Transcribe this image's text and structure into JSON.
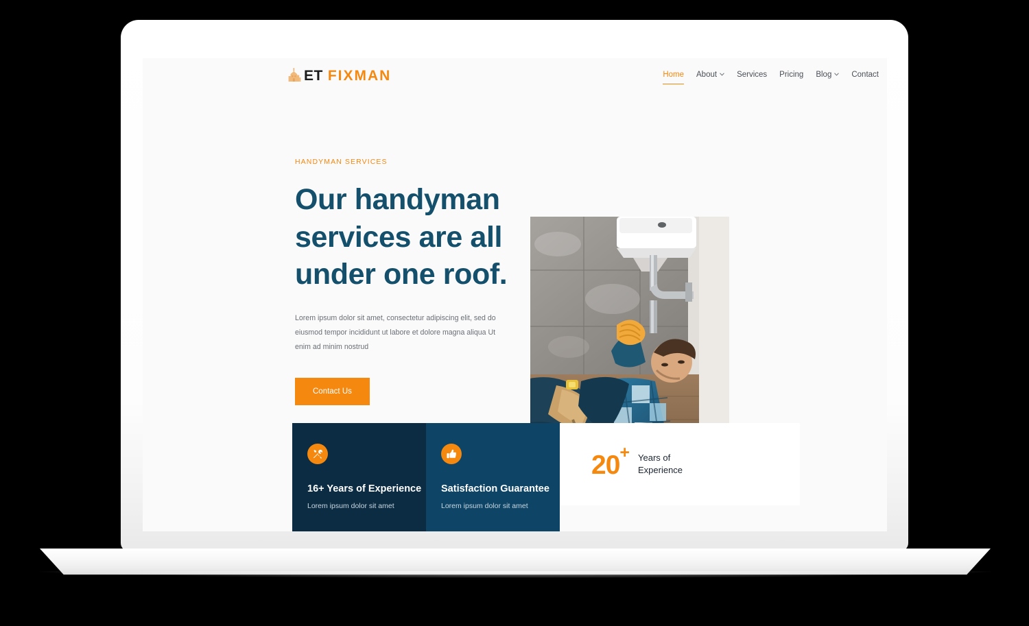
{
  "site": {
    "logo": {
      "icon": "handyman-tool-icon",
      "text_dark": "ET",
      "text_accent": "FIXMAN"
    },
    "nav": [
      {
        "label": "Home",
        "active": true,
        "dropdown": false
      },
      {
        "label": "About",
        "active": false,
        "dropdown": true
      },
      {
        "label": "Services",
        "active": false,
        "dropdown": false
      },
      {
        "label": "Pricing",
        "active": false,
        "dropdown": false
      },
      {
        "label": "Blog",
        "active": false,
        "dropdown": true
      },
      {
        "label": "Contact",
        "active": false,
        "dropdown": false
      }
    ],
    "hero": {
      "eyebrow": "HANDYMAN SERVICES",
      "title_line1": "Our handyman",
      "title_line2": "services are all",
      "title_line3": "under one roof.",
      "description": "Lorem ipsum dolor sit amet, consectetur adipiscing elit, sed do eiusmod tempor incididunt ut labore et dolore magna aliqua Ut enim ad minim nostrud",
      "cta_label": "Contact Us",
      "image_alt": "plumber-under-sink-photo"
    },
    "features": [
      {
        "icon": "tools-icon",
        "title": "16+ Years of Experience",
        "description": "Lorem ipsum dolor sit amet"
      },
      {
        "icon": "thumbs-up-icon",
        "title": "Satisfaction Guarantee",
        "description": "Lorem ipsum dolor sit amet"
      }
    ],
    "stat": {
      "number": "20",
      "suffix": "+",
      "label_line1": "Years of",
      "label_line2": "Experience"
    },
    "colors": {
      "accent_orange": "#f5880f",
      "heading_navy": "#14506b",
      "card_dark": "#0c2c43",
      "card_dark_alt": "#0e4566",
      "page_bg": "#fafafa"
    }
  }
}
